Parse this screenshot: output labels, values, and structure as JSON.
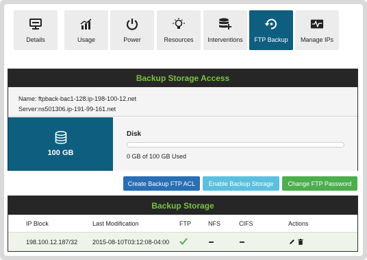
{
  "tabs": [
    {
      "label": "Details",
      "icon": "server-icon",
      "active": false
    },
    {
      "label": "Usage",
      "icon": "chart-icon",
      "active": false
    },
    {
      "label": "Power",
      "icon": "power-icon",
      "active": false
    },
    {
      "label": "Resources",
      "icon": "lightbulb-icon",
      "active": false
    },
    {
      "label": "Interventions",
      "icon": "database-plus-icon",
      "active": false
    },
    {
      "label": "FTP Backup",
      "icon": "restore-icon",
      "active": true
    },
    {
      "label": "Manage IPs",
      "icon": "pulse-monitor-icon",
      "active": false
    }
  ],
  "access_panel": {
    "title": "Backup Storage Access",
    "name_line": "Name: ftpback-bac1-128.ip-198-100-12.net",
    "server_line": "Server:ns501306.ip-191-99-161.net",
    "storage_size": "100 GB",
    "disk_title": "Disk",
    "disk_used_text": "0 GB of 100 GB Used",
    "disk_used_fraction": 0
  },
  "buttons": {
    "create_acl": "Create Backup FTP ACL",
    "enable_storage": "Enable Backup Storage",
    "change_password": "Change FTP Password"
  },
  "storage_panel": {
    "title": "Backup Storage",
    "columns": [
      "IP Block",
      "Last Modification",
      "FTP",
      "NFS",
      "CIFS",
      "Actions"
    ],
    "rows": [
      {
        "ip_block": "198.100.12.187/32",
        "last_modification": "2015-08-10T03:12:08-04:00",
        "ftp": true,
        "nfs": false,
        "cifs": false
      }
    ]
  },
  "colors": {
    "accent": "#0e5e7f",
    "header_green": "#7cc142",
    "primary_button": "#2a6eb5",
    "info_button": "#5bc0de",
    "success_button": "#4cae4c"
  }
}
